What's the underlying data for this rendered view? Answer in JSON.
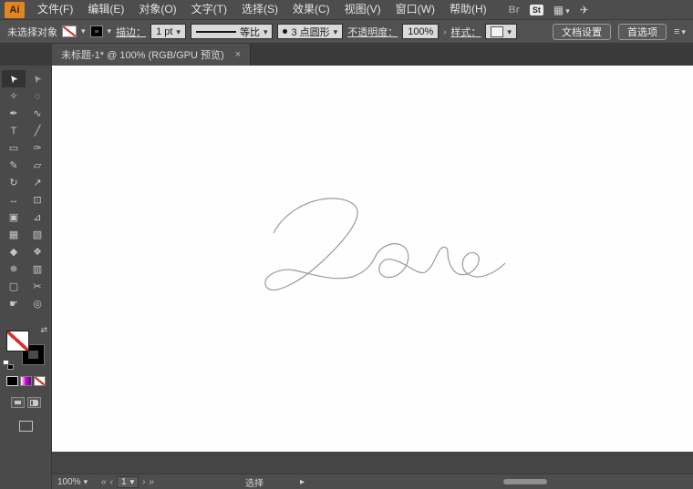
{
  "app": {
    "logo": "Ai"
  },
  "menubar": {
    "items": [
      "文件(F)",
      "编辑(E)",
      "对象(O)",
      "文字(T)",
      "选择(S)",
      "效果(C)",
      "视图(V)",
      "窗口(W)",
      "帮助(H)"
    ],
    "bridge_badge": "Br",
    "stock_badge": "St"
  },
  "controlbar": {
    "selection_status": "未选择对象",
    "stroke_label": "描边：",
    "stroke_weight": "1 pt",
    "variable_width_profile": "等比",
    "brush_definition": "3 点圆形",
    "opacity_label": "不透明度：",
    "opacity_value": "100%",
    "style_label": "样式：",
    "document_setup_button": "文档设置",
    "preferences_button": "首选项"
  },
  "document_tab": {
    "title": "未标题-1* @ 100% (RGB/GPU 预览)"
  },
  "toolbar": {
    "tools": [
      {
        "name": "selection-tool",
        "glyph": "➤",
        "active": true
      },
      {
        "name": "direct-selection-tool",
        "glyph": "➤"
      },
      {
        "name": "magic-wand-tool",
        "glyph": "✧"
      },
      {
        "name": "lasso-tool",
        "glyph": "◌"
      },
      {
        "name": "pen-tool",
        "glyph": "✒"
      },
      {
        "name": "curvature-tool",
        "glyph": "∿"
      },
      {
        "name": "type-tool",
        "glyph": "T"
      },
      {
        "name": "line-segment-tool",
        "glyph": "╱"
      },
      {
        "name": "rectangle-tool",
        "glyph": "▭"
      },
      {
        "name": "paintbrush-tool",
        "glyph": "✑"
      },
      {
        "name": "pencil-tool",
        "glyph": "✎"
      },
      {
        "name": "eraser-tool",
        "glyph": "▱"
      },
      {
        "name": "rotate-tool",
        "glyph": "↻"
      },
      {
        "name": "scale-tool",
        "glyph": "↗"
      },
      {
        "name": "width-tool",
        "glyph": "↔"
      },
      {
        "name": "free-transform-tool",
        "glyph": "⊡"
      },
      {
        "name": "shape-builder-tool",
        "glyph": "▣"
      },
      {
        "name": "perspective-grid-tool",
        "glyph": "⊿"
      },
      {
        "name": "mesh-tool",
        "glyph": "▦"
      },
      {
        "name": "gradient-tool",
        "glyph": "▧"
      },
      {
        "name": "eyedropper-tool",
        "glyph": "◆"
      },
      {
        "name": "blend-tool",
        "glyph": "❖"
      },
      {
        "name": "symbol-sprayer-tool",
        "glyph": "✵"
      },
      {
        "name": "column-graph-tool",
        "glyph": "▥"
      },
      {
        "name": "artboard-tool",
        "glyph": "▢"
      },
      {
        "name": "slice-tool",
        "glyph": "✂"
      },
      {
        "name": "hand-tool",
        "glyph": "☛"
      },
      {
        "name": "zoom-tool",
        "glyph": "◎"
      }
    ]
  },
  "artwork": {
    "word": "Love",
    "stroke_color": "#9a9a9a"
  },
  "statusbar": {
    "zoom": "100%",
    "artboard_number": "1",
    "status_text": "选择"
  }
}
